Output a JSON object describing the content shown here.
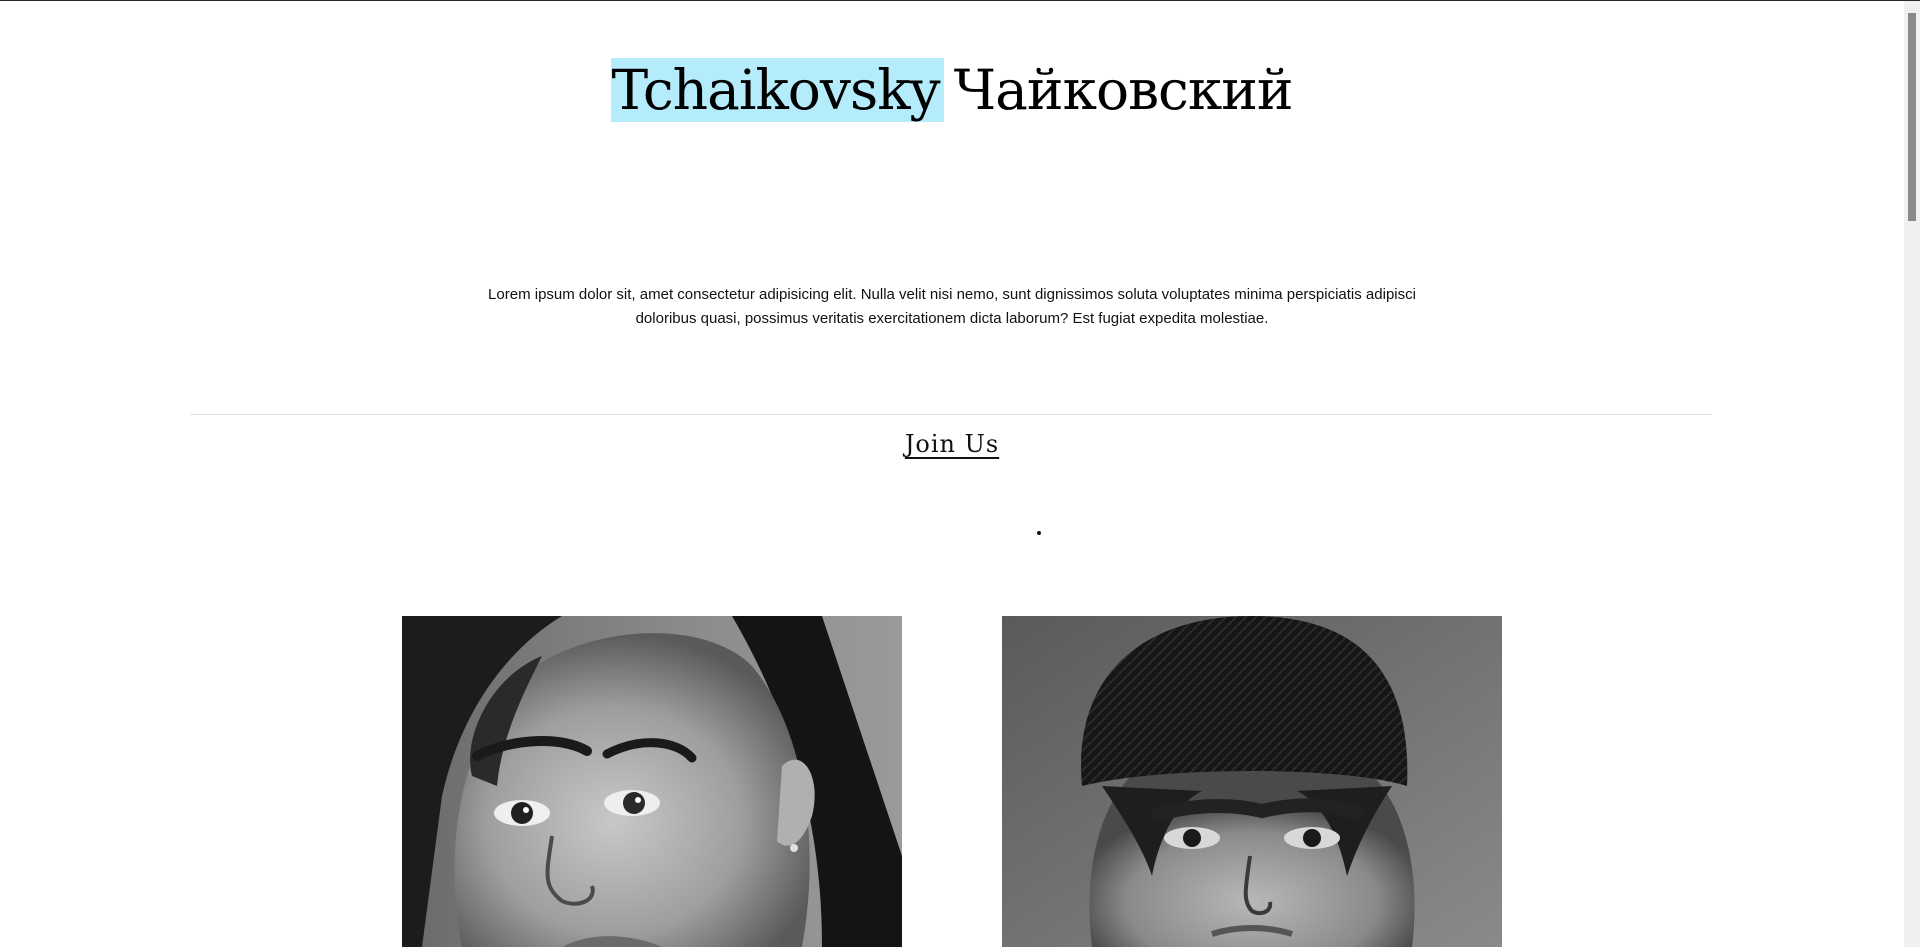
{
  "header": {
    "title_latin": "Tchaikovsky",
    "title_cyrillic": "Чайковский",
    "highlight_color": "#b4ecfc"
  },
  "intro": {
    "text": "Lorem ipsum dolor sit, amet consectetur adipisicing elit. Nulla velit nisi nemo, sunt dignissimos soluta voluptates minima perspiciatis adipisci doloribus quasi, possimus veritatis exercitationem dicta laborum? Est fugiat expedita molestiae."
  },
  "cta": {
    "join_label": "Join Us"
  },
  "gallery": {
    "items": [
      {
        "subject": "portrait-woman-hair-pulled-back"
      },
      {
        "subject": "portrait-woman-knit-beanie"
      }
    ]
  }
}
